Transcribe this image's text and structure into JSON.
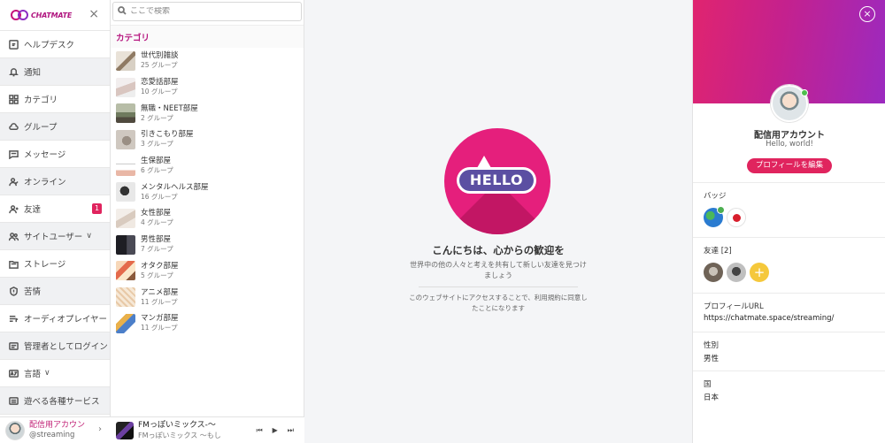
{
  "app": {
    "logo_text": "CHATMATE",
    "close_symbol": "×"
  },
  "sidebar": {
    "items": [
      {
        "label": "ヘルプデスク",
        "icon": "help-icon"
      },
      {
        "label": "通知",
        "icon": "bell-icon"
      },
      {
        "label": "カテゴリ",
        "icon": "grid-icon"
      },
      {
        "label": "グループ",
        "icon": "cloud-icon"
      },
      {
        "label": "メッセージ",
        "icon": "message-icon"
      },
      {
        "label": "オンライン",
        "icon": "user-check-icon"
      },
      {
        "label": "友達",
        "icon": "user-plus-icon",
        "badge": "1"
      },
      {
        "label": "サイトユーザー",
        "icon": "users-icon",
        "chevron": "∨"
      },
      {
        "label": "ストレージ",
        "icon": "storage-icon"
      },
      {
        "label": "苦情",
        "icon": "shield-icon"
      },
      {
        "label": "オーディオプレイヤー",
        "icon": "playlist-icon"
      },
      {
        "label": "管理者としてログイン",
        "icon": "admin-icon"
      },
      {
        "label": "言語",
        "icon": "language-icon",
        "chevron": "∨"
      },
      {
        "label": "遊べる各種サービス",
        "icon": "services-icon"
      }
    ],
    "user": {
      "name": "配信用アカウン",
      "handle": "@streaming",
      "chevron": "›"
    }
  },
  "categories": {
    "search_placeholder": "ここで検索",
    "title": "カテゴリ",
    "items": [
      {
        "name": "世代別雑談",
        "count": "25 グループ"
      },
      {
        "name": "恋愛話部屋",
        "count": "10 グループ"
      },
      {
        "name": "無職・NEET部屋",
        "count": "2 グループ"
      },
      {
        "name": "引きこもり部屋",
        "count": "3 グループ"
      },
      {
        "name": "生保部屋",
        "count": "6 グループ"
      },
      {
        "name": "メンタルヘルス部屋",
        "count": "16 グループ"
      },
      {
        "name": "女性部屋",
        "count": "4 グループ"
      },
      {
        "name": "男性部屋",
        "count": "7 グループ"
      },
      {
        "name": "オタク部屋",
        "count": "5 グループ"
      },
      {
        "name": "アニメ部屋",
        "count": "11 グループ"
      },
      {
        "name": "マンガ部屋",
        "count": "11 グループ"
      }
    ]
  },
  "player": {
    "title": "FMっぽいミックス-〜",
    "subtitle": "FMっぽいミックス 〜もし",
    "prev": "⏮",
    "play": "▶",
    "next": "⏭"
  },
  "main": {
    "hello": "HELLO",
    "welcome_title": "こんにちは、心からの歓迎を",
    "welcome_sub": "世界中の他の人々と考えを共有して新しい友達を見つけましょう",
    "terms": "このウェブサイトにアクセスすることで、利用規約に同意したことになります"
  },
  "profile": {
    "close_symbol": "×",
    "name": "配信用アカウント",
    "status": "Hello, world!",
    "edit_button": "プロフィールを編集",
    "badges_label": "バッジ",
    "friends_label": "友達 [2]",
    "friends_add": "+",
    "url_label": "プロフィールURL",
    "url_value": "https://chatmate.space/streaming/",
    "gender_label": "性別",
    "gender_value": "男性",
    "country_label": "国",
    "country_value": "日本"
  },
  "colors": {
    "accent": "#e0245e",
    "brand": "#b6157f",
    "banner_start": "#e0246f",
    "banner_end": "#9b2ac0",
    "online": "#4fbf4f"
  }
}
